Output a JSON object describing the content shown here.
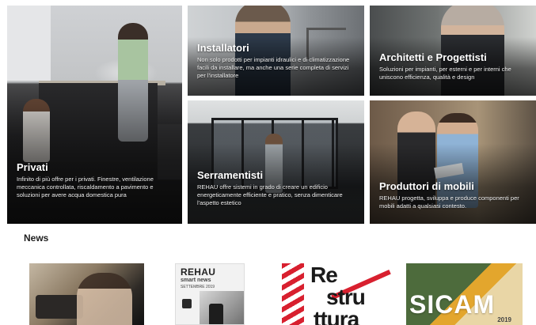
{
  "tiles": {
    "privati": {
      "title": "Privati",
      "desc": "Infinito di più offre per i privati. Finestre, ventilazione meccanica controllata, riscaldamento a pavimento e soluzioni per avere acqua domestica pura"
    },
    "installatori": {
      "title": "Installatori",
      "desc": "Non solo prodotti per impianti idraulici e di climatizzazione facili da installare, ma anche una serie completa di servizi per l'installatore"
    },
    "architetti": {
      "title": "Architetti e Progettisti",
      "desc": "Soluzioni per impianti, per esterni e per interni che uniscono efficienza, qualità e design"
    },
    "serramentisti": {
      "title": "Serramentisti",
      "desc": "REHAU offre sistemi in grado di creare un edificio energeticamente efficiente e pratico, senza dimenticare l'aspetto estetico"
    },
    "produttori": {
      "title": "Produttori di mobili",
      "desc": "REHAU progetta, sviluppa e produce componenti per mobili adatti a qualsiasi contesto."
    }
  },
  "news": {
    "heading": "News",
    "card2": {
      "brand": "REHAU",
      "sub_line1": "smart news",
      "sub_line2": "SETTEMBRE 2019"
    },
    "card3": {
      "line1": "Re",
      "line2": "stru",
      "line3": "ttura"
    },
    "card4": {
      "label": "SICAM",
      "year": "2019"
    }
  }
}
